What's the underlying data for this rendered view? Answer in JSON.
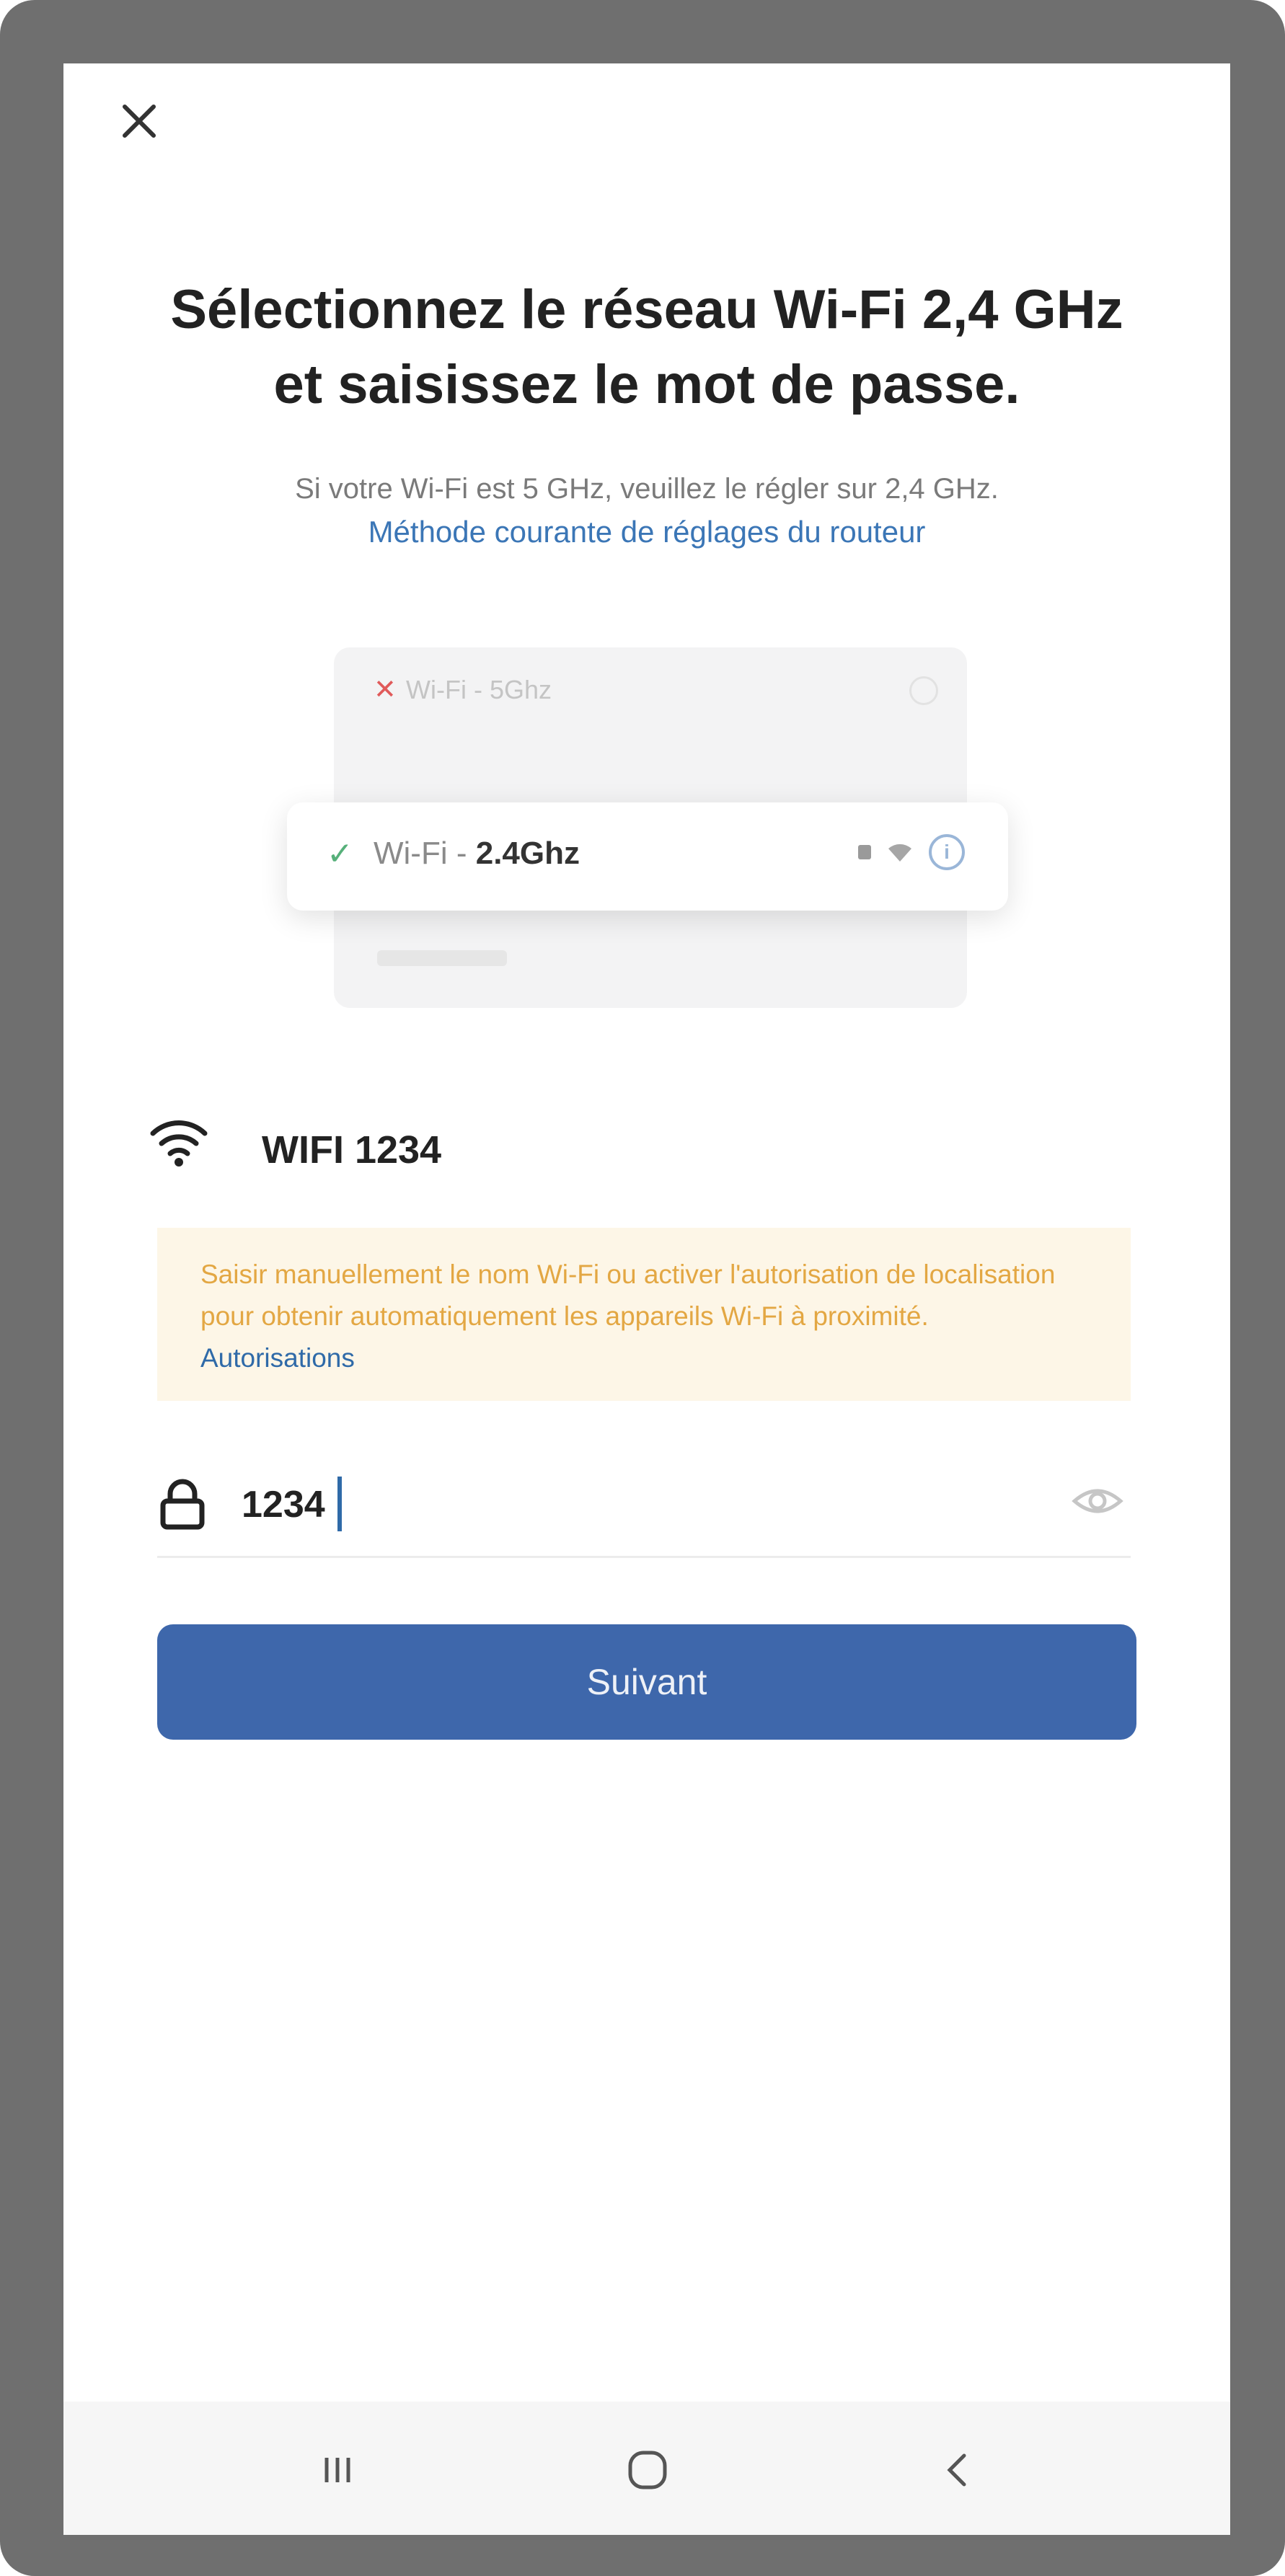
{
  "header": {
    "close_icon": "close-icon"
  },
  "title": {
    "line1": "Sélectionnez le réseau Wi-Fi 2,4 GHz",
    "line2": "et saisissez le mot de passe."
  },
  "subtitle": "Si votre Wi-Fi est 5 GHz, veuillez le régler sur 2,4 GHz.",
  "router_link": "Méthode courante de réglages du routeur",
  "illustration": {
    "row_5ghz_mark": "✕",
    "row_5ghz_label": "Wi-Fi - 5Ghz",
    "row_24_mark": "✓",
    "row_24_prefix": "Wi-Fi - ",
    "row_24_bold": "2.4Ghz",
    "info_glyph": "i"
  },
  "ssid": {
    "icon": "wifi-icon",
    "value": "WIFI 1234"
  },
  "warning": {
    "text": "Saisir manuellement le nom Wi-Fi ou activer l'autorisation de localisation pour obtenir automatiquement les appareils Wi-Fi à proximité.",
    "link": "Autorisations"
  },
  "password": {
    "icon": "lock-icon",
    "value": "1234",
    "toggle_icon": "eye-icon"
  },
  "next_button": {
    "label": "Suivant"
  },
  "navbar": {
    "recents_icon": "recents-icon",
    "home_icon": "home-icon",
    "back_icon": "back-icon"
  },
  "colors": {
    "accent": "#3e67ab",
    "link": "#3b76b6",
    "warning_bg": "#fdf6e7",
    "warning_text": "#e3a743"
  }
}
